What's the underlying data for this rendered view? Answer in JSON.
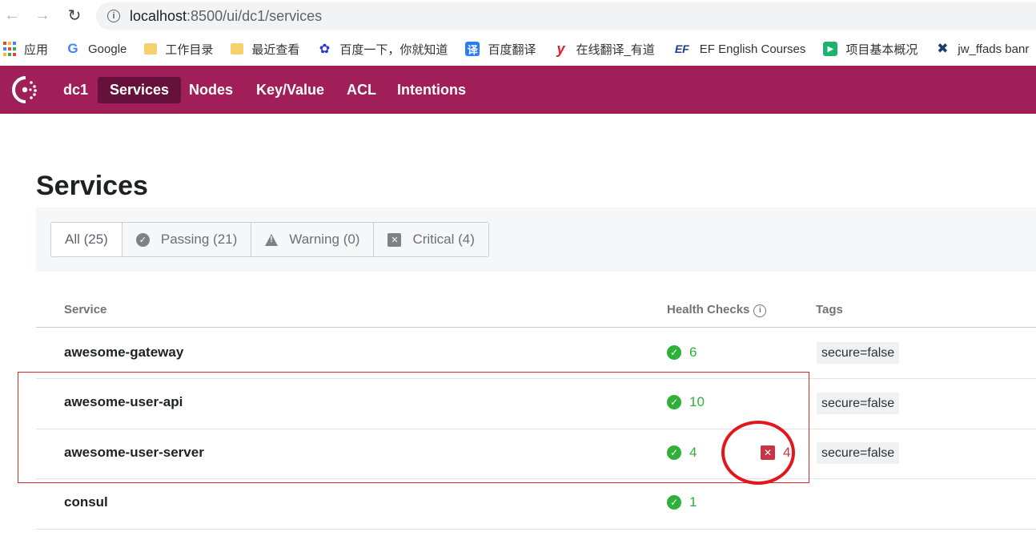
{
  "browser": {
    "url_host": "localhost",
    "url_path": ":8500/ui/dc1/services",
    "bookmarks": [
      {
        "icon": "apps-icon",
        "label": "应用"
      },
      {
        "icon": "google-icon",
        "label": "Google"
      },
      {
        "icon": "folder-icon",
        "label": "工作目录"
      },
      {
        "icon": "folder-icon",
        "label": "最近查看"
      },
      {
        "icon": "baidu-icon",
        "label": "百度一下，你就知道"
      },
      {
        "icon": "fanyi-icon",
        "label": "百度翻译"
      },
      {
        "icon": "youdao-icon",
        "label": "在线翻译_有道"
      },
      {
        "icon": "ef-icon",
        "label": "EF English Courses"
      },
      {
        "icon": "project-icon",
        "label": "项目基本概况"
      },
      {
        "icon": "jw-icon",
        "label": "jw_ffads banr"
      }
    ]
  },
  "header": {
    "brand_color": "#a11f59",
    "datacenter": "dc1",
    "nav": [
      "Services",
      "Nodes",
      "Key/Value",
      "ACL",
      "Intentions"
    ],
    "active_nav": "Services"
  },
  "page": {
    "title": "Services",
    "filters": [
      {
        "label": "All (25)",
        "icon": null,
        "active": true
      },
      {
        "label": "Passing (21)",
        "icon": "check-circle-icon",
        "active": false
      },
      {
        "label": "Warning (0)",
        "icon": "warning-icon",
        "active": false
      },
      {
        "label": "Critical (4)",
        "icon": "critical-x-icon",
        "active": false
      }
    ],
    "columns": {
      "service": "Service",
      "health": "Health Checks",
      "tags": "Tags"
    },
    "rows": [
      {
        "name": "awesome-gateway",
        "passing": "6",
        "critical": null,
        "tag": "secure=false"
      },
      {
        "name": "awesome-user-api",
        "passing": "10",
        "critical": null,
        "tag": "secure=false"
      },
      {
        "name": "awesome-user-server",
        "passing": "4",
        "critical": "4",
        "tag": "secure=false"
      },
      {
        "name": "consul",
        "passing": "1",
        "critical": null,
        "tag": null
      }
    ]
  },
  "colors": {
    "passing": "#2eb039",
    "critical": "#c73445",
    "annotation": "#e3161c"
  }
}
